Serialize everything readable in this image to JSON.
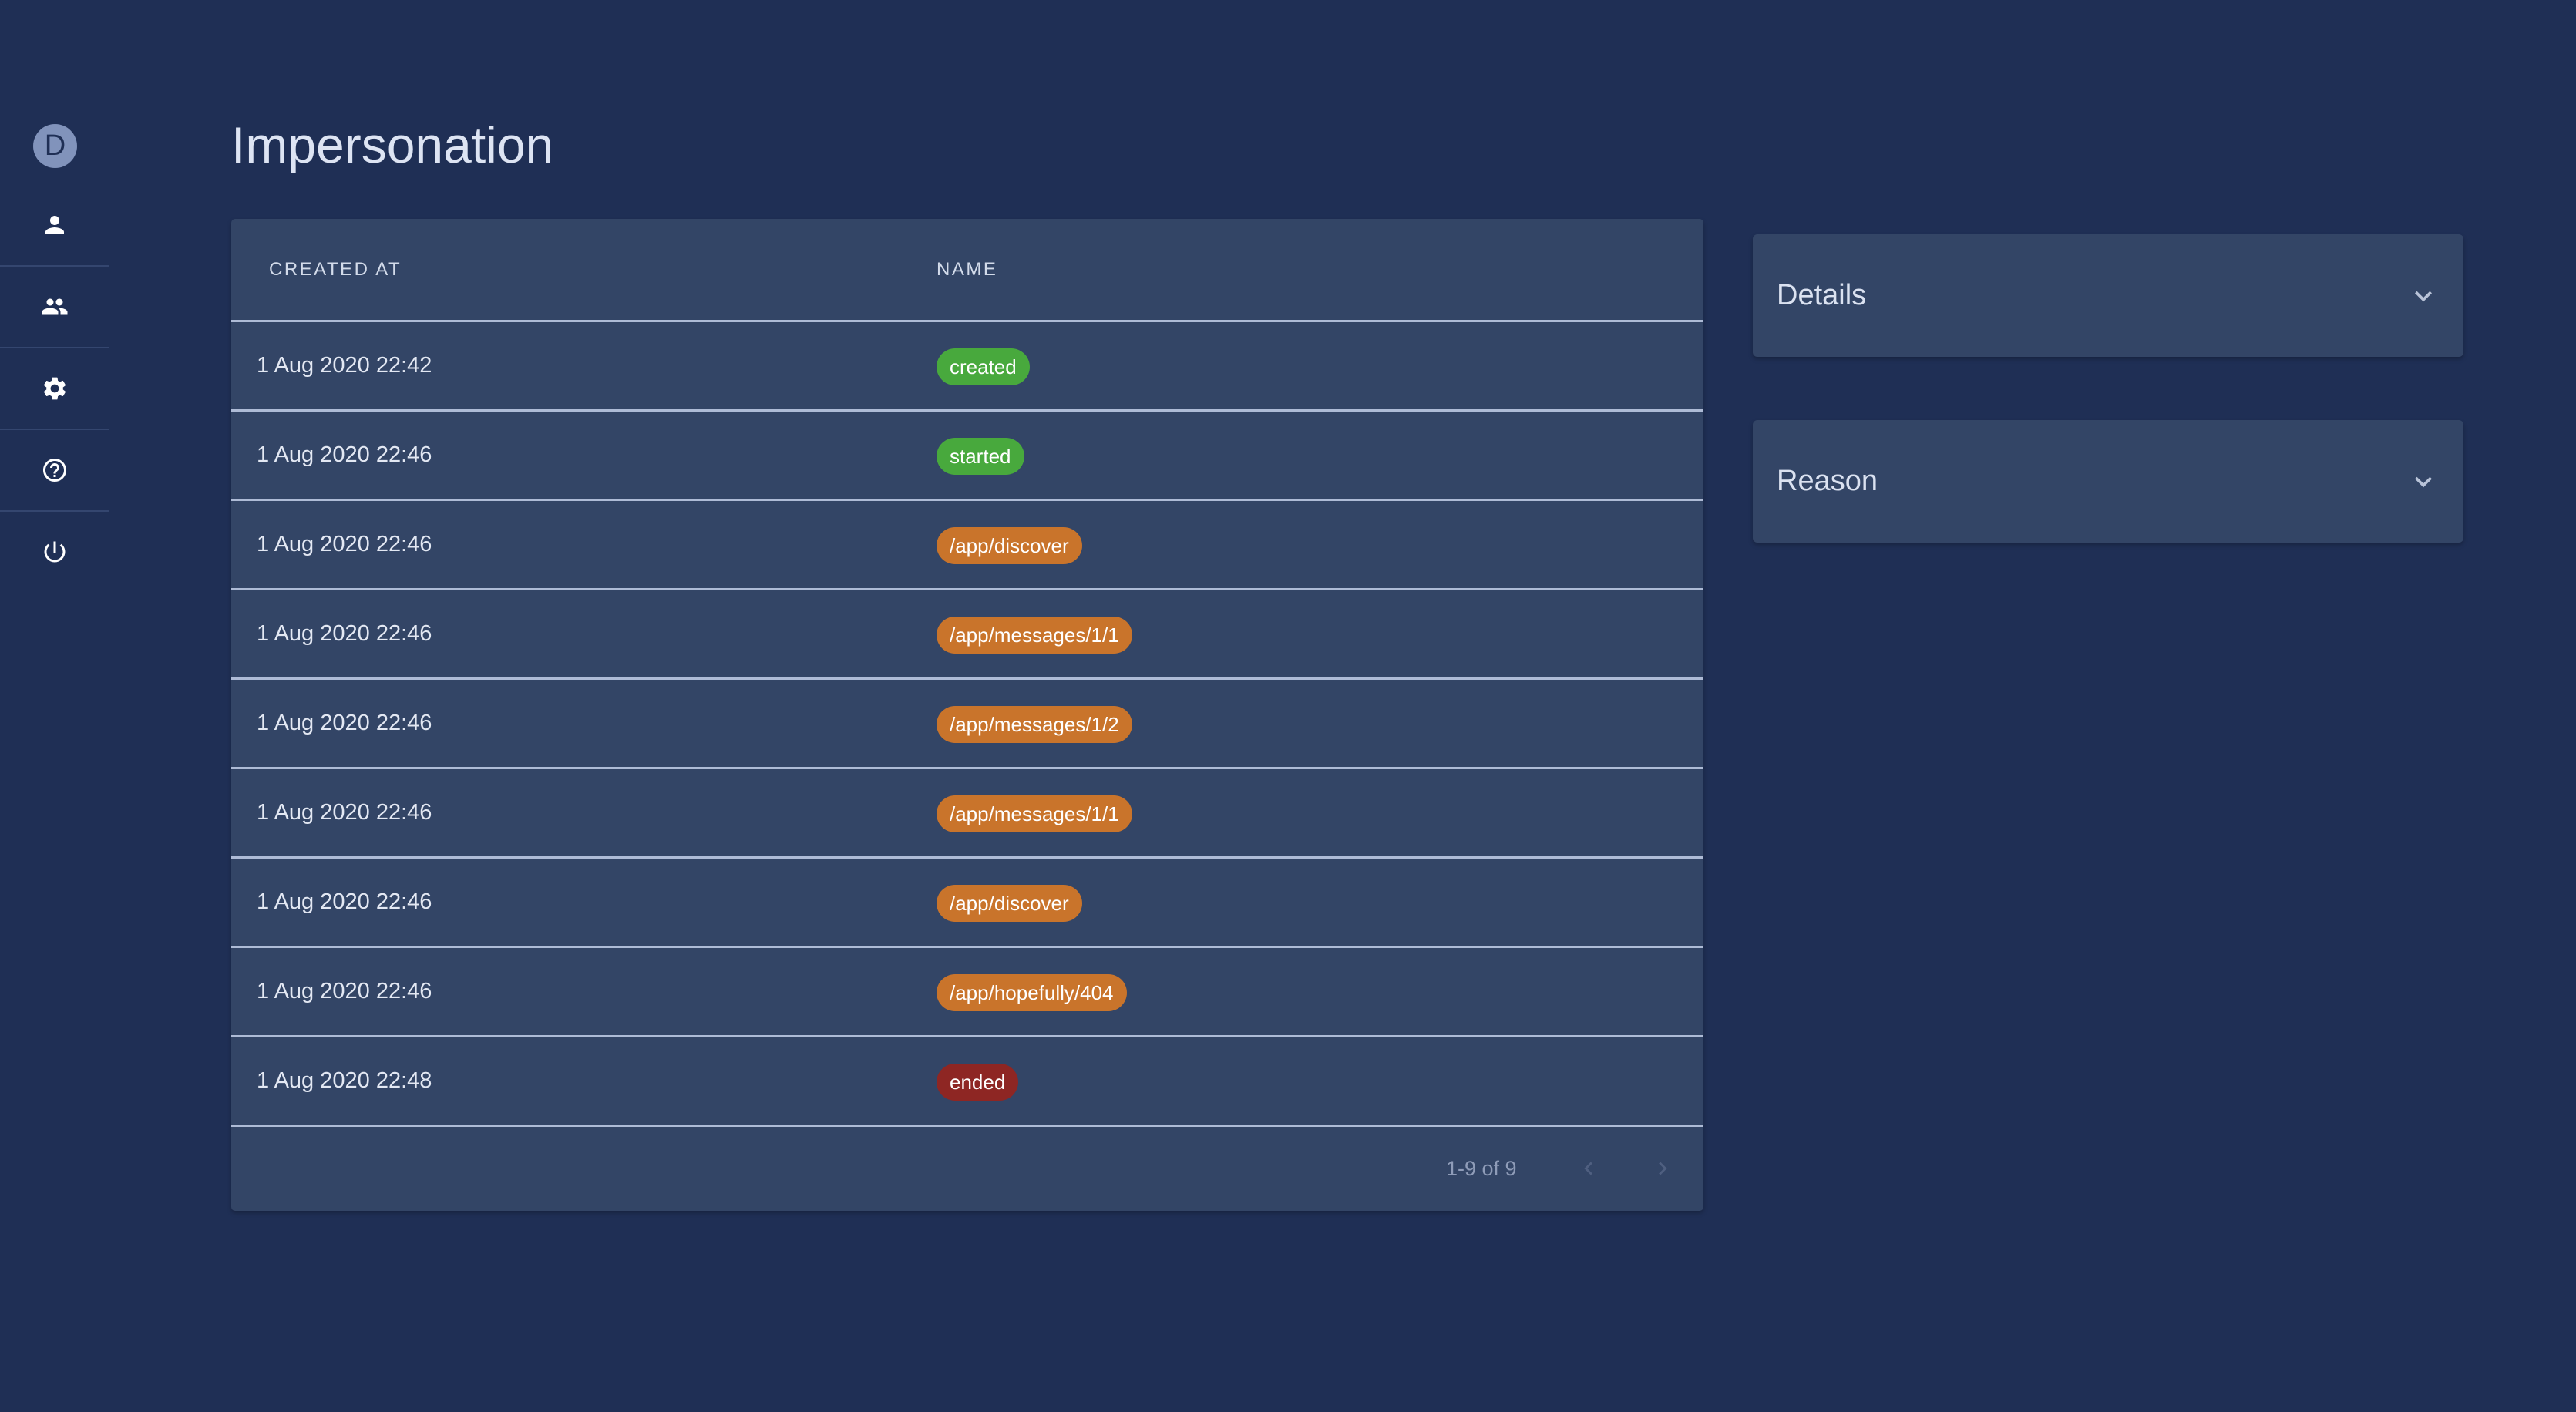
{
  "user": {
    "avatar_initial": "D"
  },
  "sidebar": {
    "items": [
      {
        "icon": "person-icon"
      },
      {
        "icon": "group-icon"
      },
      {
        "icon": "gear-icon"
      },
      {
        "icon": "help-icon"
      },
      {
        "icon": "power-icon"
      }
    ]
  },
  "page": {
    "title": "Impersonation"
  },
  "table": {
    "columns": [
      "CREATED AT",
      "NAME"
    ],
    "rows": [
      {
        "created_at": "1 Aug 2020 22:42",
        "name": "created",
        "status": "green"
      },
      {
        "created_at": "1 Aug 2020 22:46",
        "name": "started",
        "status": "green"
      },
      {
        "created_at": "1 Aug 2020 22:46",
        "name": "/app/discover",
        "status": "orange"
      },
      {
        "created_at": "1 Aug 2020 22:46",
        "name": "/app/messages/1/1",
        "status": "orange"
      },
      {
        "created_at": "1 Aug 2020 22:46",
        "name": "/app/messages/1/2",
        "status": "orange"
      },
      {
        "created_at": "1 Aug 2020 22:46",
        "name": "/app/messages/1/1",
        "status": "orange"
      },
      {
        "created_at": "1 Aug 2020 22:46",
        "name": "/app/discover",
        "status": "orange"
      },
      {
        "created_at": "1 Aug 2020 22:46",
        "name": "/app/hopefully/404",
        "status": "orange"
      },
      {
        "created_at": "1 Aug 2020 22:48",
        "name": "ended",
        "status": "red"
      }
    ],
    "pagination": {
      "label": "1-9 of 9"
    }
  },
  "panels": {
    "details": {
      "title": "Details"
    },
    "reason": {
      "title": "Reason"
    }
  },
  "colors": {
    "background": "#1f2f55",
    "card": "#334566",
    "chip_green": "#48a93d",
    "chip_orange": "#c9742b",
    "chip_red": "#8e2623"
  }
}
